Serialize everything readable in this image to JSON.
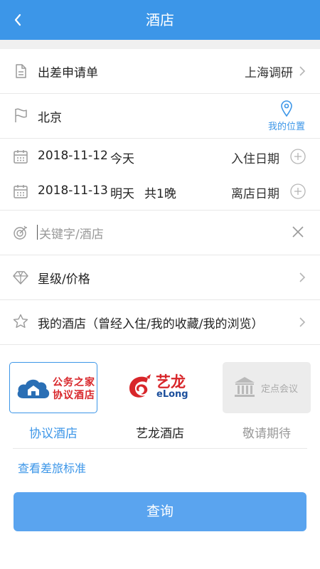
{
  "header": {
    "title": "酒店"
  },
  "form": {
    "trip_label": "出差申请单",
    "trip_value": "上海调研",
    "city": "北京",
    "my_location": "我的位置",
    "checkin_date": "2018-11-12",
    "checkin_day": "今天",
    "checkin_label": "入住日期",
    "checkout_date": "2018-11-13",
    "checkout_day": "明天",
    "nights": "共1晚",
    "checkout_label": "离店日期",
    "keyword_placeholder": "关键字/酒店",
    "star_price": "星级/价格",
    "my_hotel": "我的酒店（曾经入住/我的收藏/我的浏览）"
  },
  "cards": [
    {
      "logo_line1": "公务之家",
      "logo_line2": "协议酒店",
      "label": "协议酒店"
    },
    {
      "logo_cn": "艺龙",
      "logo_en": "eLong",
      "label": "艺龙酒店"
    },
    {
      "logo_text": "定点会议",
      "label": "敬请期待"
    }
  ],
  "travel_standard_link": "查看差旅标准",
  "search_button": "查询",
  "colors": {
    "primary": "#3c96e8",
    "button": "#5aa4ef",
    "elong_red": "#d8262a",
    "muted": "#999999"
  }
}
